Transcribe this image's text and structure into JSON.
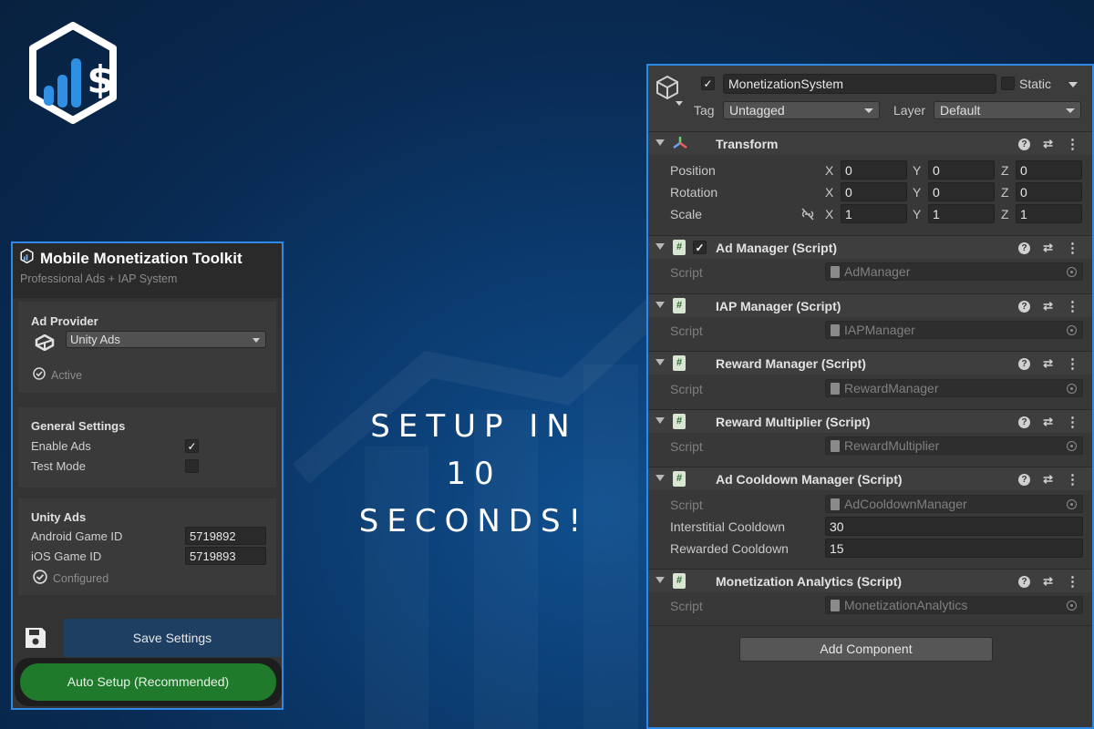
{
  "headline": {
    "line1": "SETUP IN",
    "line2": "10",
    "line3": "SECONDS!"
  },
  "logo": {
    "icon": "chart-dollar-hexagon-icon"
  },
  "toolkit": {
    "title": "Mobile Monetization Toolkit",
    "subtitle": "Professional Ads + IAP System",
    "ad_provider": {
      "section_title": "Ad Provider",
      "selected": "Unity Ads",
      "status": "Active"
    },
    "general": {
      "section_title": "General Settings",
      "enable_ads_label": "Enable Ads",
      "enable_ads_checked": true,
      "test_mode_label": "Test Mode",
      "test_mode_checked": false
    },
    "unity_ads": {
      "section_title": "Unity Ads",
      "android_label": "Android Game ID",
      "android_value": "5719892",
      "ios_label": "iOS Game ID",
      "ios_value": "5719893",
      "status": "Configured"
    },
    "save_label": "Save Settings",
    "auto_setup_label": "Auto Setup (Recommended)"
  },
  "inspector": {
    "object_name": "MonetizationSystem",
    "static_label": "Static",
    "tag_label": "Tag",
    "tag_value": "Untagged",
    "layer_label": "Layer",
    "layer_value": "Default",
    "transform": {
      "title": "Transform",
      "position_label": "Position",
      "rotation_label": "Rotation",
      "scale_label": "Scale",
      "axis_x": "X",
      "axis_y": "Y",
      "axis_z": "Z",
      "position": [
        "0",
        "0",
        "0"
      ],
      "rotation": [
        "0",
        "0",
        "0"
      ],
      "scale": [
        "1",
        "1",
        "1"
      ]
    },
    "script_label": "Script",
    "components": [
      {
        "title": "Ad Manager (Script)",
        "script": "AdManager"
      },
      {
        "title": "IAP Manager (Script)",
        "script": "IAPManager"
      },
      {
        "title": "Reward Manager (Script)",
        "script": "RewardManager"
      },
      {
        "title": "Reward Multiplier (Script)",
        "script": "RewardMultiplier"
      },
      {
        "title": "Ad Cooldown Manager (Script)",
        "script": "AdCooldownManager"
      },
      {
        "title": "Monetization Analytics (Script)",
        "script": "MonetizationAnalytics"
      }
    ],
    "cooldown": {
      "interstitial_label": "Interstitial Cooldown",
      "interstitial_value": "30",
      "rewarded_label": "Rewarded Cooldown",
      "rewarded_value": "15"
    },
    "add_component_label": "Add Component"
  },
  "colors": {
    "accent_border": "#2e8ae6",
    "auto_setup_green": "#1f7a2c",
    "save_blue": "#1f3f62"
  }
}
